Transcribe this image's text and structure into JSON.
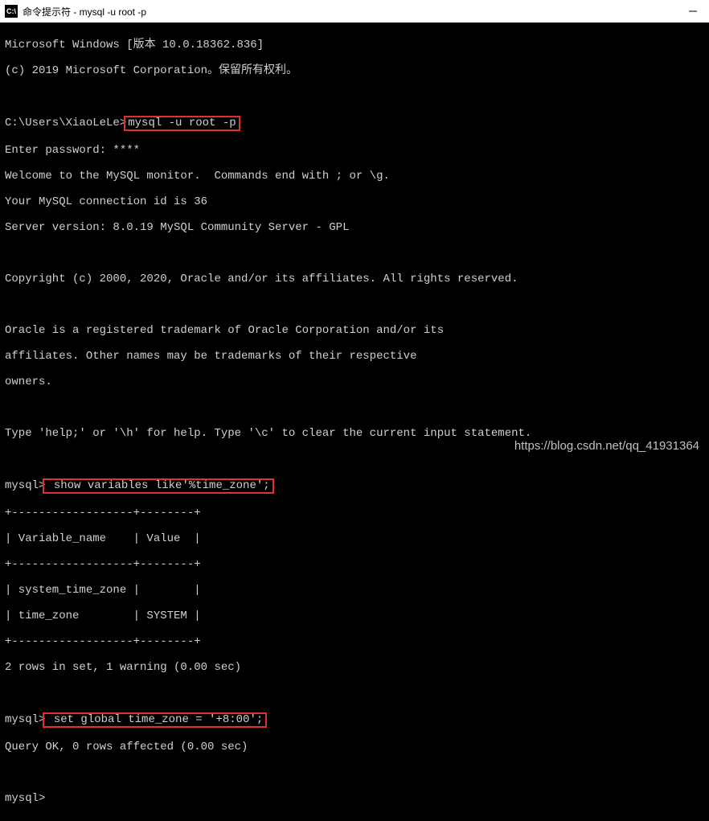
{
  "titlebar": {
    "icon_label": "C:\\",
    "title": "命令提示符 - mysql  -u root -p"
  },
  "terminal": {
    "win_version": "Microsoft Windows [版本 10.0.18362.836]",
    "copyright_win": "(c) 2019 Microsoft Corporation。保留所有权利。",
    "prompt_path": "C:\\Users\\XiaoLeLe>",
    "cmd_login": "mysql -u root -p",
    "enter_password": "Enter password: ****",
    "welcome": "Welcome to the MySQL monitor.  Commands end with ; or \\g.",
    "conn_id": "Your MySQL connection id is 36",
    "server_version": "Server version: 8.0.19 MySQL Community Server - GPL",
    "copyright_oracle": "Copyright (c) 2000, 2020, Oracle and/or its affiliates. All rights reserved.",
    "trademark1": "Oracle is a registered trademark of Oracle Corporation and/or its",
    "trademark2": "affiliates. Other names may be trademarks of their respective",
    "trademark3": "owners.",
    "help_line": "Type 'help;' or '\\h' for help. Type '\\c' to clear the current input statement.",
    "mysql_prompt": "mysql>",
    "cmd_show_vars": " show variables like'%time_zone';",
    "table_border": "+------------------+--------+",
    "table_header": "| Variable_name    | Value  |",
    "table_row1": "| system_time_zone |        |",
    "table_row2": "| time_zone        | SYSTEM |",
    "rows_summary": "2 rows in set, 1 warning (0.00 sec)",
    "cmd_set_tz": " set global time_zone = '+8:00';",
    "query_ok": "Query OK, 0 rows affected (0.00 sec)"
  },
  "watermark": "https://blog.csdn.net/qq_41931364",
  "colors": {
    "highlight": "#e03030",
    "bg": "#000000",
    "fg": "#d0d0d0"
  }
}
